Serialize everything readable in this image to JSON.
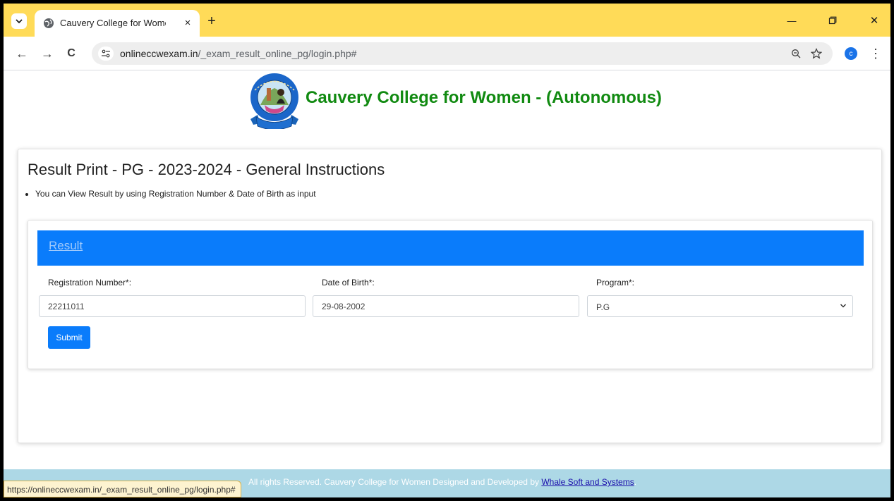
{
  "browser": {
    "tab_title": "Cauvery College for Women - (/",
    "tab_close": "×",
    "new_tab": "+",
    "url_host": "onlineccwexam.in",
    "url_path": "/_exam_result_online_pg/login.php#",
    "profile_initial": "c",
    "minimize": "—",
    "close": "✕",
    "back": "←",
    "forward": "→",
    "reload": "C",
    "menu": "⋮",
    "status_url": "https://onlineccwexam.in/_exam_result_online_pg/login.php#"
  },
  "header": {
    "college_name": "Cauvery College for Women - (Autonomous)"
  },
  "card": {
    "title": "Result Print - PG - 2023-2024 - General Instructions",
    "instructions": [
      "You can View Result by using Registration Number & Date of Birth as input"
    ]
  },
  "form": {
    "panel_title": "Result",
    "registration_label": "Registration Number*:",
    "registration_value": "22211011",
    "dob_label": "Date of Birth*:",
    "dob_value": "29-08-2002",
    "program_label": "Program*:",
    "program_selected": "P.G",
    "submit_label": "Submit"
  },
  "footer": {
    "text": "All rights Reserved. Cauvery College for Women Designed and Developed by ",
    "link": "Whale Soft and Systems",
    "end": "."
  },
  "colors": {
    "tab_strip": "#ffdb58",
    "accent_blue": "#0a7cfb",
    "title_green": "#118a11",
    "footer_bg": "#add8e6"
  }
}
